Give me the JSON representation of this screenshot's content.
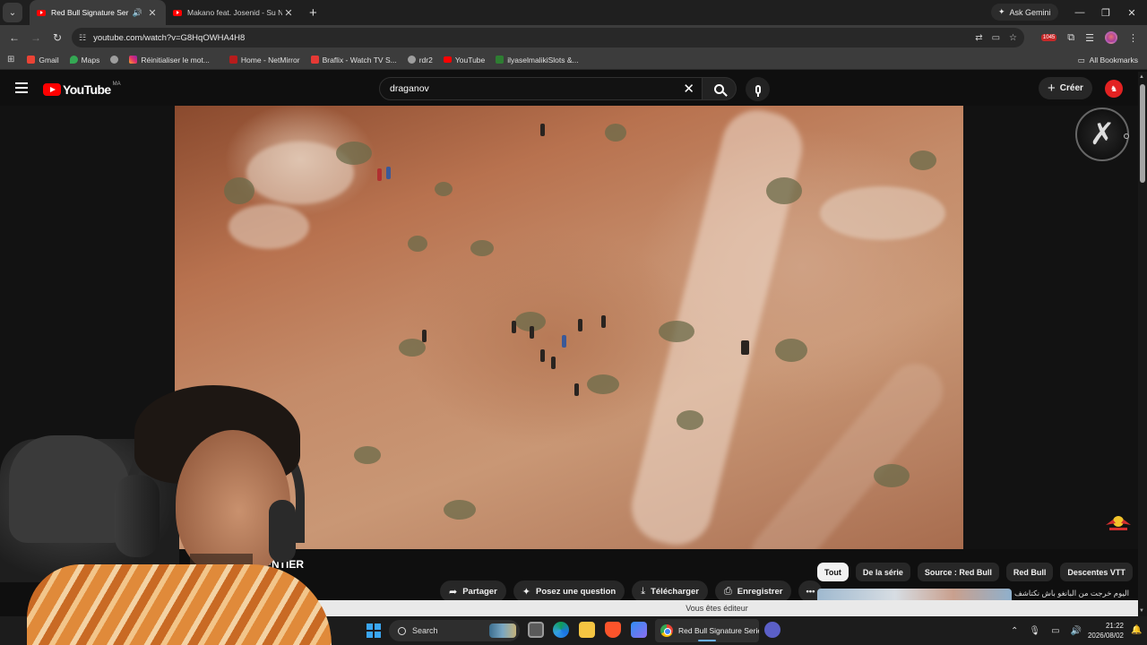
{
  "browser": {
    "tabs": [
      {
        "title": "Red Bull Signature Series –",
        "active": true,
        "audio": true
      },
      {
        "title": "Makano feat. Josenid - Su Nom",
        "active": false,
        "audio": false
      }
    ],
    "ask_gemini": "Ask Gemini",
    "url": "youtube.com/watch?v=G8HqOWHA4H8",
    "extension_badge": "1045",
    "bookmarks": [
      {
        "label": "Gmail",
        "color": "#ea4335"
      },
      {
        "label": "Maps",
        "color": "#34a853"
      },
      {
        "label": "",
        "color": "#9e9e9e"
      },
      {
        "label": "Réinitialiser le mot...",
        "color": "#e1306c"
      },
      {
        "label": "Home - NetMirror",
        "color": "#b71c1c"
      },
      {
        "label": "Braflix - Watch TV S...",
        "color": "#e53935"
      },
      {
        "label": "rdr2",
        "color": "#9e9e9e"
      },
      {
        "label": "YouTube",
        "color": "#ff0000"
      },
      {
        "label": "ilyaselmalikiSlots &...",
        "color": "#2e7d32"
      }
    ],
    "all_bookmarks": "All Bookmarks"
  },
  "youtube": {
    "logo_text": "YouTube",
    "country_code": "MA",
    "search_value": "draganov",
    "create_label": "Créer",
    "video_title_fragment": "ENTIER",
    "actions": {
      "share": "Partager",
      "ask": "Posez une question",
      "download": "Télécharger",
      "save": "Enregistrer"
    },
    "chips": [
      "Tout",
      "De la série",
      "Source : Red Bull",
      "Red Bull",
      "Descentes VTT"
    ],
    "related_title": "اليوم خرجت من البانغو باش نكتاشف",
    "editor_notice": "Vous êtes éditeur"
  },
  "taskbar": {
    "search_label": "Search",
    "active_window": "Red Bull Signature Serie",
    "time": "21:22",
    "date": "2026/08/02"
  },
  "colors": {
    "youtube_red": "#ff0000",
    "windows_blue": "#3aa6f2",
    "chip_active": "#f1f1f1"
  }
}
